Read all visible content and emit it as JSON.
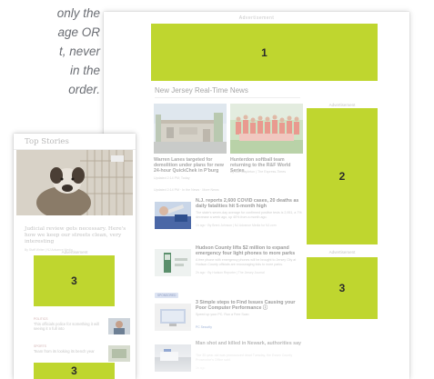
{
  "annotation": {
    "lines": [
      "only the",
      "age OR",
      "t, never",
      "in the",
      "order."
    ],
    "color": "#6b6e74"
  },
  "colors": {
    "ad_slot": "#bfd62f",
    "ad_number": "#2b2b2b"
  },
  "desktop": {
    "top_label": "Advertisement",
    "ad_slots": [
      {
        "number": "1",
        "label": "Advertisement"
      },
      {
        "number": "2",
        "label": "Advertisement"
      },
      {
        "number": "3",
        "label": "Advertisement"
      }
    ],
    "section_heading": "New Jersey Real-Time News",
    "featured": [
      {
        "headline": "Warren Lanes targeted for demolition under plans for new 24-hour QuickChek in P'burg",
        "meta": "Updated 2:14 PM; Today"
      },
      {
        "headline": "Hunterdon softball team returning to the R&F World Series",
        "meta": "By Joe Stapleton | The Express-Times"
      }
    ],
    "section_meta": "Updated 2:14 PM · In the News · More News",
    "stories": [
      {
        "title": "N.J. reports 2,600 COVID cases, 20 deaths as daily fatalities hit 5-month high",
        "body": "The state's seven-day average for confirmed positive tests is 2,951, a 7% decrease a week ago, up 40% from a month ago.",
        "meta": "1h ago · By Brent Johnson | NJ Advance Media for NJ.com"
      },
      {
        "title": "Hudson County lifts $2 million to expand emergency four light phones to more parks",
        "body": "A free phone with emergency phones will be brought to Jersey City at Hudson County officials are encouraging kids to more parks.",
        "meta": "2h ago · By Hudson Reporter | The Jersey Journal"
      },
      {
        "pill": "SPONSORED",
        "title": "3 Simple steps to Find Issues Causing your Poor Computer Performance ⓘ",
        "body": "Speed up your PC. Run a Free Scan",
        "meta": "PC Security"
      },
      {
        "title": "Man shot and killed in Newark, authorities say",
        "body": "The 30-year-old was pronounced dead Tuesday, the Essex County Prosecutor's Office said.",
        "meta": "3h ago"
      }
    ]
  },
  "mobile": {
    "title": "Top Stories",
    "ad_slots": [
      {
        "number": "3",
        "label": "Advertisement"
      },
      {
        "number": "3",
        "label": "Advertisement"
      }
    ],
    "headline": "Judicial review gets necessary. Here's how we keep our streets clean, very interesting",
    "headline_meta": "By Staff Writer | NJ Advance Media",
    "small_items": [
      {
        "kicker": "POLITICS",
        "title": "This officials police for something it will seeing it n full into"
      },
      {
        "kicker": "SPORTS",
        "title": "Team from its looking its bench year"
      }
    ]
  }
}
